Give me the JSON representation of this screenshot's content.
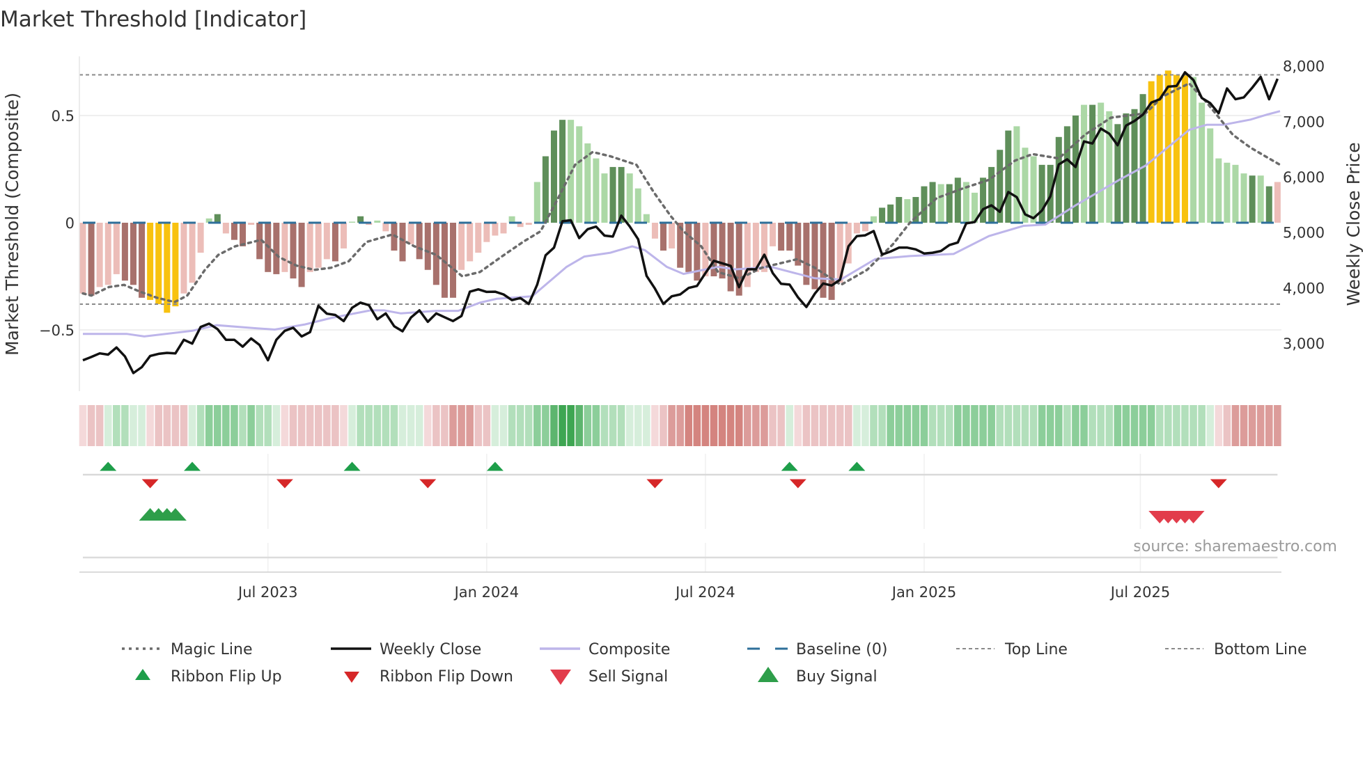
{
  "chart_data": {
    "type": "bar",
    "title": "Market Threshold [Indicator]",
    "ylabel_left": "Market Threshold (Composite)",
    "ylabel_right": "Weekly Close Price",
    "source": "source: sharemaestro.com",
    "left_axis": {
      "ticks": [
        {
          "v": 0.5,
          "label": "0.5"
        },
        {
          "v": 0,
          "label": "0"
        },
        {
          "v": -0.5,
          "label": "−0.5"
        }
      ]
    },
    "right_axis": {
      "ticks": [
        {
          "v": 8000,
          "label": "8,000"
        },
        {
          "v": 7000,
          "label": "7,000"
        },
        {
          "v": 6000,
          "label": "6,000"
        },
        {
          "v": 5000,
          "label": "5,000"
        },
        {
          "v": 4000,
          "label": "4,000"
        },
        {
          "v": 3000,
          "label": "3,000"
        }
      ]
    },
    "x_ticks": [
      {
        "week": 22,
        "label": "Jul 2023"
      },
      {
        "week": 48,
        "label": "Jan 2024"
      },
      {
        "week": 74,
        "label": "Jul 2024"
      },
      {
        "week": 100,
        "label": "Jan 2025"
      },
      {
        "week": 125.7,
        "label": "Jul 2025"
      }
    ],
    "top_line": 0.69,
    "bottom_line": -0.38,
    "baseline": 0,
    "colors": {
      "bar": {
        "L": "#ecbdb8",
        "D": "#a8716c",
        "G": "#acd8a6",
        "H": "#5f8f5a",
        "Y": "#f8c20f"
      },
      "ribbon": {
        "-4": "#d4847f",
        "-3": "#dc9c9a",
        "-2": "#ebc3c4",
        "-1": "#f4d9da",
        "1": "#d6eedb",
        "2": "#b2dfbb",
        "3": "#8cce9a",
        "4": "#5db56e",
        "5": "#3ea652"
      },
      "close": "#111111",
      "composite": "#bdb5ea",
      "magic": "#6b6b6b",
      "baseline": "#2e6f9a",
      "ref": "#8a8a8a",
      "flip_up": "#1e9e4a",
      "flip_down": "#d62728",
      "sell": "#e23c4b",
      "buy": "#2e9e4a"
    },
    "composite_bars": [
      -0.33,
      -0.34,
      -0.3,
      -0.29,
      -0.24,
      -0.27,
      -0.29,
      -0.35,
      -0.36,
      -0.38,
      -0.42,
      -0.39,
      -0.33,
      -0.28,
      -0.14,
      0.02,
      0.04,
      -0.05,
      -0.08,
      -0.11,
      -0.01,
      -0.17,
      -0.23,
      -0.24,
      -0.23,
      -0.26,
      -0.3,
      -0.23,
      -0.21,
      -0.17,
      -0.18,
      -0.12,
      0.005,
      0.03,
      -0.01,
      0.01,
      -0.04,
      -0.13,
      -0.18,
      -0.1,
      -0.17,
      -0.22,
      -0.29,
      -0.35,
      -0.35,
      -0.22,
      -0.18,
      -0.14,
      -0.09,
      -0.06,
      -0.05,
      0.03,
      -0.02,
      -0.01,
      0.19,
      0.31,
      0.43,
      0.48,
      0.48,
      0.45,
      0.37,
      0.3,
      0.23,
      0.26,
      0.26,
      0.23,
      0.16,
      0.04,
      -0.074,
      -0.13,
      -0.12,
      -0.21,
      -0.23,
      -0.27,
      -0.25,
      -0.25,
      -0.26,
      -0.32,
      -0.34,
      -0.3,
      -0.23,
      -0.23,
      -0.11,
      -0.13,
      -0.13,
      -0.2,
      -0.29,
      -0.31,
      -0.35,
      -0.36,
      -0.28,
      -0.19,
      -0.05,
      -0.04,
      0.03,
      0.07,
      0.085,
      0.12,
      0.11,
      0.12,
      0.17,
      0.19,
      0.18,
      0.18,
      0.21,
      0.19,
      0.14,
      0.21,
      0.26,
      0.34,
      0.43,
      0.45,
      0.35,
      0.31,
      0.27,
      0.27,
      0.4,
      0.45,
      0.5,
      0.55,
      0.55,
      0.56,
      0.52,
      0.46,
      0.51,
      0.53,
      0.6,
      0.66,
      0.69,
      0.71,
      0.69,
      0.69,
      0.68,
      0.56,
      0.44,
      0.3,
      0.28,
      0.27,
      0.23,
      0.22,
      0.22,
      0.17,
      0.19
    ],
    "bar_classes": "LDLLLDDDYYYYLLLGHLDDLDDDLDDLLLDLGHLGLDDLDDDDDLLLLLLGLLGHHHGGGGGHHGGGLDLDDDLDDDDLLLLDDDDDDDLLLLGHHHGHHHGHHGGHHHHGGGHHHHHGHGGHHHHYYYYYGGGGGGGHGH",
    "weekly_close": [
      2693,
      2752,
      2817,
      2794,
      2923,
      2762,
      2462,
      2568,
      2771,
      2808,
      2826,
      2817,
      3062,
      2992,
      3292,
      3352,
      3255,
      3062,
      3062,
      2937,
      3085,
      2969,
      2693,
      3062,
      3223,
      3279,
      3122,
      3200,
      3675,
      3532,
      3509,
      3399,
      3639,
      3731,
      3685,
      3431,
      3537,
      3306,
      3214,
      3463,
      3592,
      3385,
      3537,
      3468,
      3399,
      3491,
      3929,
      3971,
      3925,
      3929,
      3879,
      3777,
      3814,
      3708,
      4054,
      4585,
      4723,
      5198,
      5217,
      4894,
      5055,
      5102,
      4940,
      4922,
      5300,
      5106,
      4875,
      4215,
      3985,
      3708,
      3846,
      3879,
      3996,
      4033,
      4264,
      4486,
      4440,
      4394,
      4010,
      4333,
      4333,
      4596,
      4264,
      4070,
      4056,
      3827,
      3653,
      3893,
      4077,
      4040,
      4144,
      4746,
      4931,
      4945,
      5023,
      4598,
      4653,
      4723,
      4723,
      4691,
      4617,
      4631,
      4663,
      4769,
      4815,
      5161,
      5185,
      5415,
      5485,
      5369,
      5725,
      5633,
      5323,
      5254,
      5392,
      5646,
      6223,
      6315,
      6177,
      6638,
      6600,
      6869,
      6777,
      6569,
      6923,
      7006,
      7121,
      7338,
      7398,
      7625,
      7638,
      7883,
      7745,
      7421,
      7329,
      7144,
      7592,
      7398,
      7431,
      7606,
      7800,
      7398,
      7767
    ],
    "composite_line": [
      [
        0,
        3168
      ],
      [
        5.2,
        3168
      ],
      [
        7.3,
        3122
      ],
      [
        13,
        3223
      ],
      [
        15.9,
        3325
      ],
      [
        20.7,
        3269
      ],
      [
        22.8,
        3246
      ],
      [
        26.4,
        3339
      ],
      [
        29.5,
        3454
      ],
      [
        34.2,
        3592
      ],
      [
        35.8,
        3592
      ],
      [
        37.8,
        3537
      ],
      [
        42,
        3583
      ],
      [
        44.6,
        3583
      ],
      [
        47.2,
        3731
      ],
      [
        49.2,
        3800
      ],
      [
        53.4,
        3846
      ],
      [
        57.5,
        4377
      ],
      [
        59.6,
        4562
      ],
      [
        62.7,
        4631
      ],
      [
        65.3,
        4746
      ],
      [
        66.8,
        4677
      ],
      [
        69.4,
        4377
      ],
      [
        71.4,
        4248
      ],
      [
        75.5,
        4377
      ],
      [
        77.6,
        4331
      ],
      [
        81.8,
        4377
      ],
      [
        87,
        4171
      ],
      [
        90.1,
        4148
      ],
      [
        94.2,
        4517
      ],
      [
        98.3,
        4571
      ],
      [
        103.5,
        4608
      ],
      [
        107.7,
        4931
      ],
      [
        111.8,
        5115
      ],
      [
        114.4,
        5138
      ],
      [
        118,
        5485
      ],
      [
        123.2,
        5946
      ],
      [
        126.3,
        6200
      ],
      [
        131.5,
        6846
      ],
      [
        133.6,
        6938
      ],
      [
        135.6,
        6938
      ],
      [
        138.8,
        7031
      ],
      [
        140.8,
        7123
      ],
      [
        142.3,
        7183
      ]
    ],
    "magic_line": [
      [
        0,
        -0.33
      ],
      [
        1,
        -0.34
      ],
      [
        3.1,
        -0.3
      ],
      [
        4.9,
        -0.29
      ],
      [
        6.7,
        -0.32
      ],
      [
        8.8,
        -0.35
      ],
      [
        10.9,
        -0.37
      ],
      [
        12.4,
        -0.34
      ],
      [
        14.5,
        -0.22
      ],
      [
        16.1,
        -0.15
      ],
      [
        18.1,
        -0.11
      ],
      [
        21.2,
        -0.08
      ],
      [
        23.3,
        -0.16
      ],
      [
        25.4,
        -0.2
      ],
      [
        27.5,
        -0.22
      ],
      [
        29.5,
        -0.21
      ],
      [
        31.6,
        -0.18
      ],
      [
        33.7,
        -0.09
      ],
      [
        36.8,
        -0.055
      ],
      [
        39.4,
        -0.11
      ],
      [
        42,
        -0.15
      ],
      [
        45.1,
        -0.25
      ],
      [
        47.2,
        -0.23
      ],
      [
        49.7,
        -0.16
      ],
      [
        52.3,
        -0.09
      ],
      [
        54.4,
        -0.04
      ],
      [
        56.5,
        0.115
      ],
      [
        58.5,
        0.27
      ],
      [
        60.6,
        0.33
      ],
      [
        62.7,
        0.31
      ],
      [
        65.8,
        0.27
      ],
      [
        67.9,
        0.14
      ],
      [
        69.9,
        0.03
      ],
      [
        71.4,
        -0.04
      ],
      [
        73.5,
        -0.11
      ],
      [
        75.5,
        -0.23
      ],
      [
        78.1,
        -0.26
      ],
      [
        80.7,
        -0.21
      ],
      [
        84.9,
        -0.17
      ],
      [
        87,
        -0.21
      ],
      [
        90.1,
        -0.29
      ],
      [
        93.2,
        -0.22
      ],
      [
        96.3,
        -0.1
      ],
      [
        98.3,
        0
      ],
      [
        101.5,
        0.115
      ],
      [
        104.6,
        0.16
      ],
      [
        107.7,
        0.2
      ],
      [
        110.8,
        0.29
      ],
      [
        112.9,
        0.32
      ],
      [
        116,
        0.3
      ],
      [
        119.1,
        0.41
      ],
      [
        122.2,
        0.49
      ],
      [
        126.3,
        0.51
      ],
      [
        128.4,
        0.59
      ],
      [
        131.5,
        0.65
      ],
      [
        133.6,
        0.56
      ],
      [
        136.7,
        0.41
      ],
      [
        138.8,
        0.35
      ],
      [
        142.3,
        0.27
      ]
    ],
    "ribbon_levels": [
      -1,
      -2,
      -2,
      1,
      2,
      2,
      1,
      1,
      -1,
      -2,
      -2,
      -2,
      -2,
      1,
      2,
      3,
      3,
      3,
      3,
      2,
      3,
      2,
      2,
      1,
      -1,
      -2,
      -2,
      -2,
      -2,
      -2,
      -2,
      -1,
      1,
      2,
      2,
      2,
      2,
      2,
      1,
      1,
      1,
      -1,
      -2,
      -2,
      -3,
      -3,
      -3,
      -2,
      -2,
      1,
      1,
      2,
      2,
      2,
      3,
      3,
      4,
      5,
      5,
      4,
      3,
      3,
      2,
      2,
      2,
      1,
      1,
      1,
      -1,
      -2,
      -3,
      -3,
      -4,
      -4,
      -4,
      -4,
      -4,
      -4,
      -4,
      -3,
      -3,
      -3,
      -2,
      -2,
      1,
      -1,
      -2,
      -2,
      -2,
      -2,
      -2,
      -2,
      1,
      1,
      2,
      2,
      3,
      3,
      3,
      3,
      3,
      2,
      2,
      2,
      3,
      3,
      3,
      3,
      3,
      2,
      2,
      2,
      2,
      2,
      3,
      3,
      3,
      2,
      3,
      3,
      2,
      2,
      2,
      3,
      3,
      3,
      3,
      3,
      2,
      2,
      2,
      2,
      2,
      2,
      1,
      -1,
      -2,
      -3,
      -3,
      -3,
      -3,
      -3,
      -3
    ],
    "ribbon_flip_up": [
      3,
      13,
      32,
      49,
      84,
      92
    ],
    "ribbon_flip_down": [
      8,
      24,
      41,
      68,
      85,
      135
    ],
    "buy_signal": [
      8,
      9,
      10,
      11
    ],
    "sell_signal": [
      128,
      129,
      130,
      131,
      132
    ],
    "legend": [
      {
        "label": "Magic Line",
        "kind": "magic"
      },
      {
        "label": "Weekly Close",
        "kind": "close"
      },
      {
        "label": "Composite",
        "kind": "composite"
      },
      {
        "label": "Baseline (0)",
        "kind": "baseline"
      },
      {
        "label": "Top Line",
        "kind": "ref"
      },
      {
        "label": "Bottom Line",
        "kind": "ref"
      },
      {
        "label": "Ribbon Flip Up",
        "kind": "flip_up"
      },
      {
        "label": "Ribbon Flip Down",
        "kind": "flip_down"
      },
      {
        "label": "Sell Signal",
        "kind": "sell"
      },
      {
        "label": "Buy Signal",
        "kind": "buy"
      }
    ]
  }
}
